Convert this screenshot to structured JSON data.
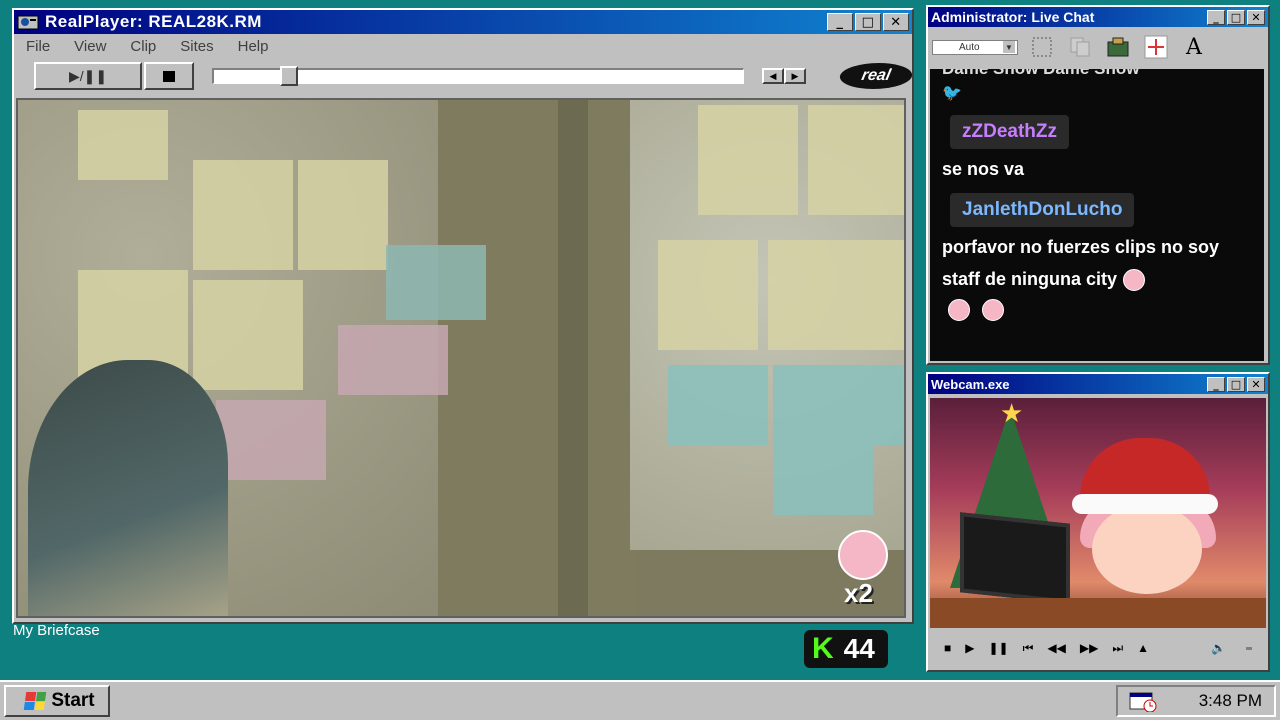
{
  "realplayer": {
    "title": "RealPlayer: REAL28K.RM",
    "menu": [
      "File",
      "View",
      "Clip",
      "Sites",
      "Help"
    ],
    "play_pause_label": "▶/❚❚",
    "logo_text": "real",
    "overlay_multiplier": "x2",
    "seek_progress_percent": 13
  },
  "desktop": {
    "briefcase_label": "My Briefcase",
    "kick_logo": "K",
    "viewer_count": "44"
  },
  "chat": {
    "title": "Administrator: Live Chat",
    "font_size_select": "Auto",
    "clipped_message": "Dame Snow Dame Snow",
    "messages": [
      {
        "user": "zZDeathZz",
        "user_color": "#c77dff",
        "text": "se nos va"
      },
      {
        "user": "JanlethDonLucho",
        "user_color": "#7cb8ff",
        "text": "porfavor no fuerzes clips no soy staff de ninguna city"
      }
    ]
  },
  "webcam": {
    "title": "Webcam.exe"
  },
  "taskbar": {
    "start_label": "Start",
    "clock": "3:48 PM"
  },
  "colors": {
    "desktop": "#0f8080",
    "titlebar": "#000080",
    "kick_green": "#53fc18"
  }
}
